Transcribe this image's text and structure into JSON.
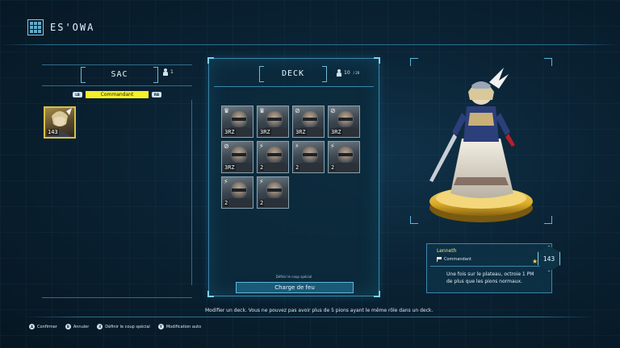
{
  "header": {
    "title": "ES'OWA",
    "icon": "grid-icon"
  },
  "sac": {
    "tab_label": "SAC",
    "count": "1",
    "filter_left_button": "LB",
    "filter_label": "Commandant",
    "filter_right_button": "RB",
    "card": {
      "cost": "143"
    }
  },
  "deck": {
    "tab_label": "DECK",
    "count_current": "10",
    "count_max": "/ 20",
    "cards": [
      {
        "role": "♛",
        "cost": "3RZ"
      },
      {
        "role": "♛",
        "cost": "3RZ"
      },
      {
        "role": "⊘",
        "cost": "3RZ"
      },
      {
        "role": "⊘",
        "cost": "3RZ"
      },
      {
        "role": "⊘",
        "cost": "3RZ"
      },
      {
        "role": "⚡",
        "cost": "2"
      },
      {
        "role": "⚡",
        "cost": "2"
      },
      {
        "role": "⚡",
        "cost": "2"
      },
      {
        "role": "⚡",
        "cost": "2"
      },
      {
        "role": "⚡",
        "cost": "2"
      }
    ],
    "special_hint": "Définir le coup spécial",
    "special_button": "Charge de feu"
  },
  "info": {
    "name": "Lenneth",
    "role": "Commandant",
    "stars": "5",
    "cost": "143",
    "description": "Une fois sur le plateau, octroie 1 PM de plus que les pions normaux."
  },
  "hint": "Modifier un deck. Vous ne pouvez pas avoir plus de 5 pions ayant le même rôle dans un deck.",
  "footer": {
    "confirm": "Confirmer",
    "cancel": "Annuler",
    "special": "Définir le coup spécial",
    "auto": "Modification auto",
    "confirm_btn": "A",
    "cancel_btn": "B",
    "special_btn": "X",
    "auto_btn": "Y"
  },
  "colors": {
    "accent": "#7fd0f0",
    "highlight": "#f4f02a",
    "gold": "#d9a927"
  }
}
